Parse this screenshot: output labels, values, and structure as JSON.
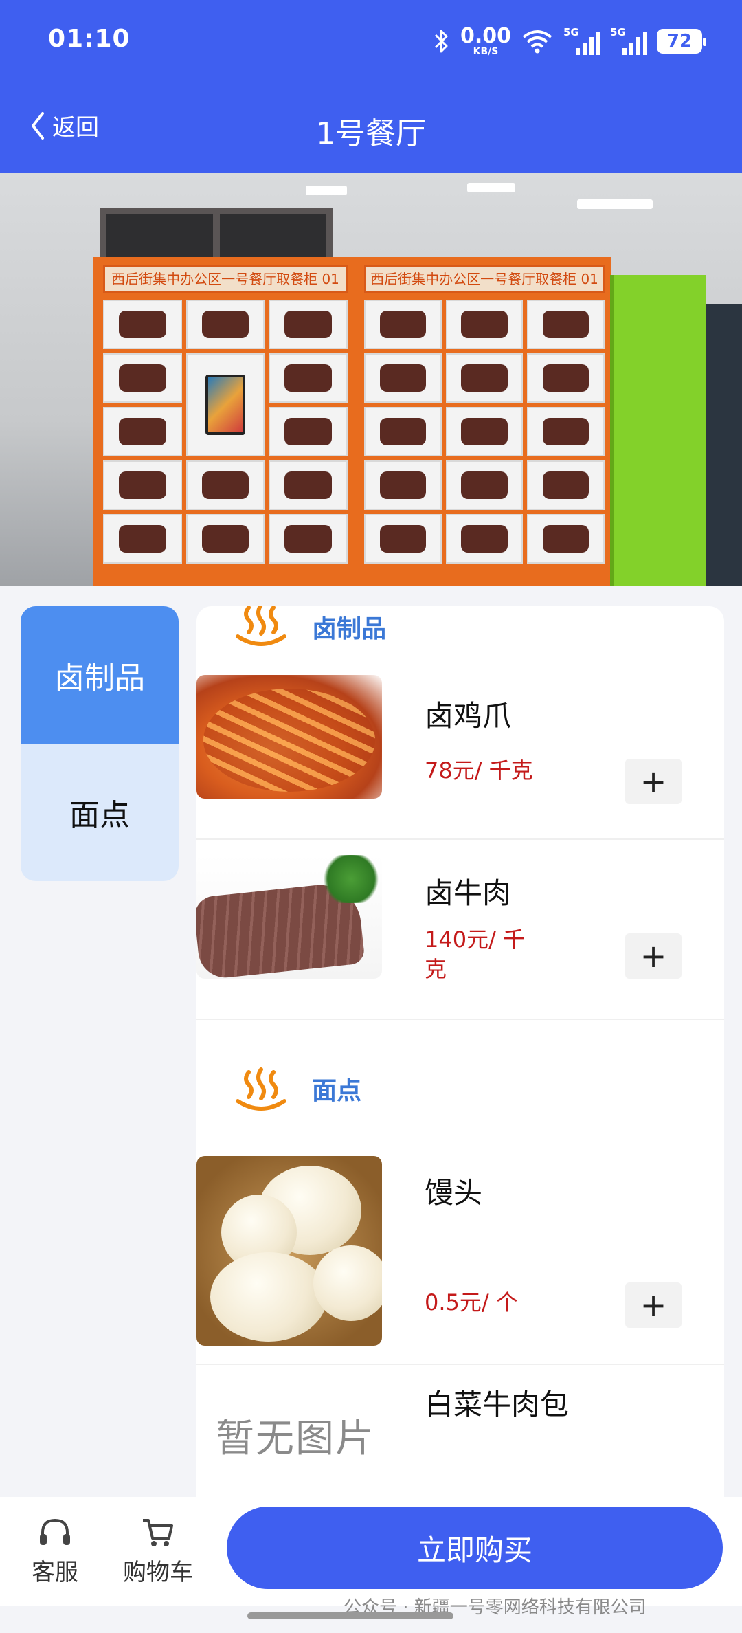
{
  "status_bar": {
    "time": "01:10",
    "net_speed_value": "0.00",
    "net_speed_unit": "KB/S",
    "signal_1_label": "5G",
    "signal_2_label": "5G",
    "battery": "72"
  },
  "nav": {
    "back_label": "返回",
    "title": "1号餐厅"
  },
  "hero": {
    "locker_sign_left": "西后街集中办公区一号餐厅取餐柜 01",
    "locker_sign_right": "西后街集中办公区一号餐厅取餐柜 01"
  },
  "categories": [
    {
      "label": "卤制品",
      "active": true
    },
    {
      "label": "面点",
      "active": false
    }
  ],
  "sections": [
    {
      "title": "卤制品",
      "items": [
        {
          "name": "卤鸡爪",
          "price": "78元/ 千克",
          "add": "+"
        },
        {
          "name": "卤牛肉",
          "price": "140元/ 千克",
          "add": "+"
        }
      ]
    },
    {
      "title": "面点",
      "items": [
        {
          "name": "馒头",
          "price": "0.5元/ 个",
          "add": "+"
        },
        {
          "name": "白菜牛肉包",
          "no_image_text": "暂无图片"
        }
      ]
    }
  ],
  "bottom_bar": {
    "service_label": "客服",
    "cart_label": "购物车",
    "buy_label": "立即购买"
  },
  "watermark": "公众号 · 新疆一号零网络科技有限公司",
  "colors": {
    "primary": "#3f5ff0",
    "category_active": "#4d8ef0",
    "category_bg": "#dce9fb",
    "price": "#c41a1a",
    "section_title": "#3b78d6",
    "steam_icon": "#f08a10"
  }
}
